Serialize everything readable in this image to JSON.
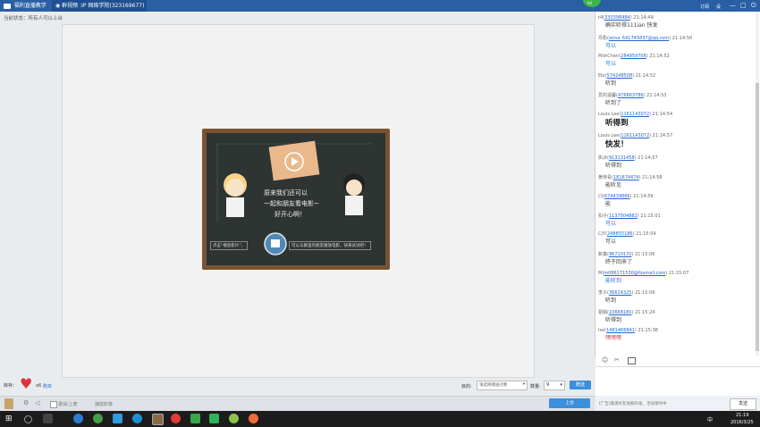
{
  "topbar": {
    "app_tab": "福利直播教学",
    "room_title": "群视频 :IP 网络学院(323169677)",
    "btn_sub": "订阅",
    "btn_settings": "设",
    "btn_min": "—",
    "btn_max": "□",
    "btn_close": "⏻",
    "avatar_badge": "64"
  },
  "notice": "当前状态：所有人可以上台",
  "board": {
    "line1": "原来我们还可以",
    "line2": "一起和朋友看电影~",
    "line3": "好开心啊！",
    "hint_left": "点击“播放影片”，",
    "hint_right": "可以与群里的朋友播放电影，快来试试吧！"
  },
  "bottom": {
    "flower_label": "库存：",
    "flower_count": "x6",
    "buy_link": "购买",
    "dest_label": "目的:",
    "dest_select": "请选择赠送对象",
    "qty_label": "数量:",
    "qty_value": "9",
    "send_gift": "赠送"
  },
  "footer": {
    "mic_label": "邀请/上麦",
    "play_label": "播放影像",
    "stage_btn": "上台"
  },
  "chat": {
    "messages": [
      {
        "name": "t4",
        "uid": "330398484",
        "time": "21:14:49",
        "text": "确实听得111ian 快发",
        "big": false
      },
      {
        "name": "丹影",
        "uid": "anna_641745837@qq.com",
        "time": "21:14:50",
        "text": "可以",
        "big": false,
        "blue": true
      },
      {
        "name": "MistChen",
        "uid": "284959706",
        "time": "21:14:52",
        "text": "可以",
        "big": false,
        "blue": true
      },
      {
        "name": "Elo",
        "uid": "574248508",
        "time": "21:14:52",
        "text": "听到",
        "big": false
      },
      {
        "name": "爱的温馨",
        "uid": "476863786",
        "time": "21:14:53",
        "text": "听到了",
        "big": false
      },
      {
        "name": "Louis Lee",
        "uid": "1161143072",
        "time": "21:14:54",
        "text": "听得到",
        "big": true
      },
      {
        "name": "Louis Lee",
        "uid": "1161143072",
        "time": "21:14:57",
        "text": "快发！",
        "big": true
      },
      {
        "name": "执冰",
        "uid": "913131458",
        "time": "21:14:57",
        "text": "听得到",
        "big": false
      },
      {
        "name": "黄伟青",
        "uid": "181674474",
        "time": "21:14:58",
        "text": "能听见",
        "big": false
      },
      {
        "name": "口",
        "uid": "674439866",
        "time": "21:14:59",
        "text": "能",
        "big": false
      },
      {
        "name": "扣子",
        "uid": "1137504882",
        "time": "21:15:01",
        "text": "可以",
        "big": false,
        "blue": true
      },
      {
        "name": "CJY",
        "uid": "248855186",
        "time": "21:15:04",
        "text": "可以",
        "big": false
      },
      {
        "name": "新童",
        "uid": "96710170",
        "time": "21:15:06",
        "text": "终于回来了",
        "big": false
      },
      {
        "name": "M",
        "uid": "m086171530@foxmail.com",
        "time": "21:15:07",
        "text": "能听到",
        "big": false,
        "blue": true
      },
      {
        "name": "李子",
        "uid": "36614325",
        "time": "21:15:09",
        "text": "听到",
        "big": false
      },
      {
        "name": "祖娟",
        "uid": "10668180",
        "time": "21:15:24",
        "text": "听得到",
        "big": false
      },
      {
        "name": "Ise",
        "uid": "1481466841",
        "time": "21:15:38",
        "text": "嘿嘿嘿",
        "big": false,
        "red": true
      }
    ],
    "footer_note": "[广告]邀请好友进群升级，活动限时中",
    "send_btn": "发送"
  },
  "taskbar": {
    "time": "21:19",
    "date": "2016/3/25",
    "lang": "中"
  },
  "colors": {
    "topbar": "#2a5fa5",
    "accent": "#3b8fdc",
    "board_frame": "#7a5334",
    "board_bg": "#2e3432"
  }
}
